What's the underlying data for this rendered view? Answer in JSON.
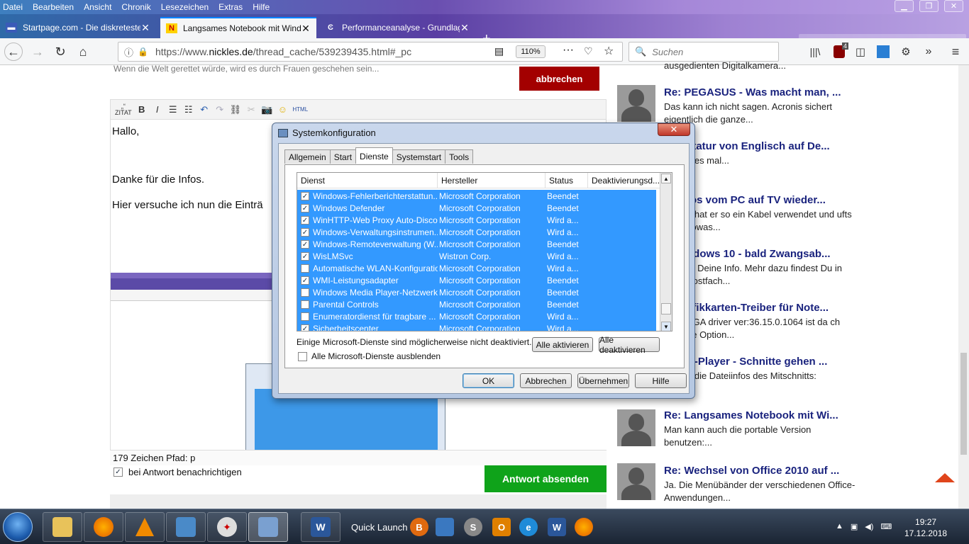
{
  "browser": {
    "menu": [
      "Datei",
      "Bearbeiten",
      "Ansicht",
      "Chronik",
      "Lesezeichen",
      "Extras",
      "Hilfe"
    ],
    "tabs": [
      {
        "title": "Startpage.com - Die diskreteste",
        "active": false
      },
      {
        "title": "Langsames Notebook mit Windo",
        "active": true
      },
      {
        "title": "Performanceanalyse - Grundlag",
        "active": false
      }
    ],
    "url_prefix": "https://www.",
    "url_domain": "nickles.de",
    "url_path": "/thread_cache/539239435.html#_pc",
    "zoom": "110%",
    "search_placeholder": "Suchen",
    "badge_count": "4"
  },
  "editor": {
    "top_faded_text": "Wenn die Welt gerettet würde, wird es durch Frauen geschehen sein...",
    "cancel_button": "abbrechen",
    "toolbar_zitat": "ZITAT",
    "toolbar_html": "HTML",
    "line1": "Hallo,",
    "line2": "Danke für die Infos.",
    "line3": "Hier versuche ich nun die Einträ",
    "char_count": "179 Zeichen Pfad: p",
    "notify_label": "bei Antwort benachrichtigen",
    "send_button": "Antwort absenden"
  },
  "sidebar": {
    "items": [
      {
        "title": "",
        "text": "ausgedienten Digitalkamera..."
      },
      {
        "title": "Re: PEGASUS - Was macht man, ...",
        "text": "Das kann ich nicht sagen. Acronis sichert eigentlich die ganze..."
      },
      {
        "title": "statur von Englisch auf De...",
        "text": "e es mal..."
      },
      {
        "title": "tos vom PC auf TV wieder...",
        "text": "h hat er so ein Kabel verwendet und ufts sowas..."
      },
      {
        "title": "ndows 10 - bald Zwangsab...",
        "text": "ür Deine Info. Mehr dazu findest Du in Postfach..."
      },
      {
        "title": "afikkarten-Treiber für Note...",
        "text": "VGA driver ver:36.15.0.1064 ist da ch ne Option..."
      },
      {
        "title": "C-Player - Schnitte gehen ...",
        "text": "h die Dateiinfos des Mitschnitts:"
      },
      {
        "title": "Re: Langsames Notebook mit Wi...",
        "text": "Man kann auch die portable Version benutzen:..."
      },
      {
        "title": "Re: Wechsel von Office 2010 auf ...",
        "text": "Ja. Die Menübänder der verschiedenen Office-Anwendungen..."
      }
    ]
  },
  "dialog": {
    "title": "Systemkonfiguration",
    "tabs": [
      "Allgemein",
      "Start",
      "Dienste",
      "Systemstart",
      "Tools"
    ],
    "selected_tab": "Dienste",
    "columns": [
      "Dienst",
      "Hersteller",
      "Status",
      "Deaktivierungsd..."
    ],
    "rows": [
      {
        "checked": true,
        "name": "Windows-Fehlerberichterstattun...",
        "vendor": "Microsoft Corporation",
        "status": "Beendet"
      },
      {
        "checked": true,
        "name": "Windows Defender",
        "vendor": "Microsoft Corporation",
        "status": "Beendet"
      },
      {
        "checked": true,
        "name": "WinHTTP-Web Proxy Auto-Disco...",
        "vendor": "Microsoft Corporation",
        "status": "Wird a..."
      },
      {
        "checked": true,
        "name": "Windows-Verwaltungsinstrumen...",
        "vendor": "Microsoft Corporation",
        "status": "Wird a..."
      },
      {
        "checked": true,
        "name": "Windows-Remoteverwaltung (W...",
        "vendor": "Microsoft Corporation",
        "status": "Beendet"
      },
      {
        "checked": true,
        "name": "WisLMSvc",
        "vendor": "Wistron Corp.",
        "status": "Wird a..."
      },
      {
        "checked": false,
        "name": "Automatische WLAN-Konfiguration",
        "vendor": "Microsoft Corporation",
        "status": "Wird a..."
      },
      {
        "checked": true,
        "name": "WMI-Leistungsadapter",
        "vendor": "Microsoft Corporation",
        "status": "Beendet"
      },
      {
        "checked": false,
        "name": "Windows Media Player-Netzwerk...",
        "vendor": "Microsoft Corporation",
        "status": "Beendet"
      },
      {
        "checked": false,
        "name": "Parental Controls",
        "vendor": "Microsoft Corporation",
        "status": "Beendet"
      },
      {
        "checked": false,
        "name": "Enumeratordienst für tragbare ...",
        "vendor": "Microsoft Corporation",
        "status": "Wird a..."
      },
      {
        "checked": true,
        "name": "Sicherheitscenter",
        "vendor": "Microsoft Corporation",
        "status": "Wird a..."
      }
    ],
    "note": "Einige Microsoft-Dienste sind möglicherweise nicht deaktiviert.",
    "enable_all": "Alle aktivieren",
    "disable_all": "Alle deaktivieren",
    "hide_ms_label": "Alle Microsoft-Dienste ausblenden",
    "ok": "OK",
    "cancel": "Abbrechen",
    "apply": "Übernehmen",
    "help": "Hilfe"
  },
  "taskbar": {
    "quick_launch": "Quick Launch",
    "time": "19:27",
    "date": "17.12.2018"
  },
  "colors": {
    "accent_red": "#a30000",
    "accent_green": "#0fa31a",
    "list_selection": "#3399ff",
    "sidebar_link": "#1a237e"
  }
}
